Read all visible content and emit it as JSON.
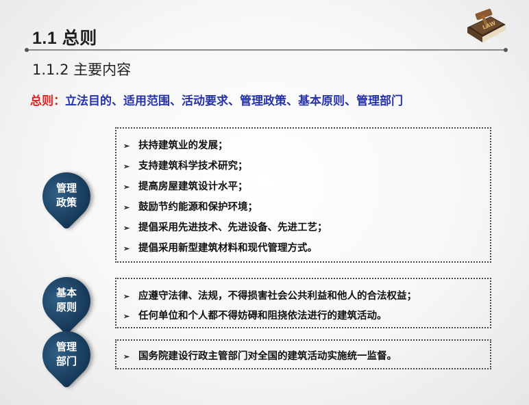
{
  "header": {
    "title": "1.1 总则",
    "subtitle": "1.1.2 主要内容",
    "logo_text": "LAW"
  },
  "summary": {
    "label": "总则：",
    "text": "立法目的、适用范围、活动要求、管理政策、基本原则、管理部门"
  },
  "sections": [
    {
      "badge_line1": "管理",
      "badge_line2": "政策",
      "items": [
        "扶持建筑业的发展；",
        "支持建筑科学技术研究；",
        "提高房屋建筑设计水平；",
        "鼓励节约能源和保护环境；",
        "提倡采用先进技术、先进设备、先进工艺；",
        "提倡采用新型建筑材料和现代管理方式。"
      ]
    },
    {
      "badge_line1": "基本",
      "badge_line2": "原则",
      "items": [
        "应遵守法律、法规，不得损害社会公共利益和他人的合法权益；",
        "任何单位和个人都不得妨碍和阻挠依法进行的建筑活动。"
      ]
    },
    {
      "badge_line1": "管理",
      "badge_line2": "部门",
      "items": [
        "国务院建设行政主管部门对全国的建筑活动实施统一监督。"
      ]
    }
  ],
  "bullet_icon": "arrow-bullet-icon",
  "colors": {
    "summary_label": "#e02020",
    "summary_text": "#2633a8",
    "badge": "#173a5a"
  }
}
